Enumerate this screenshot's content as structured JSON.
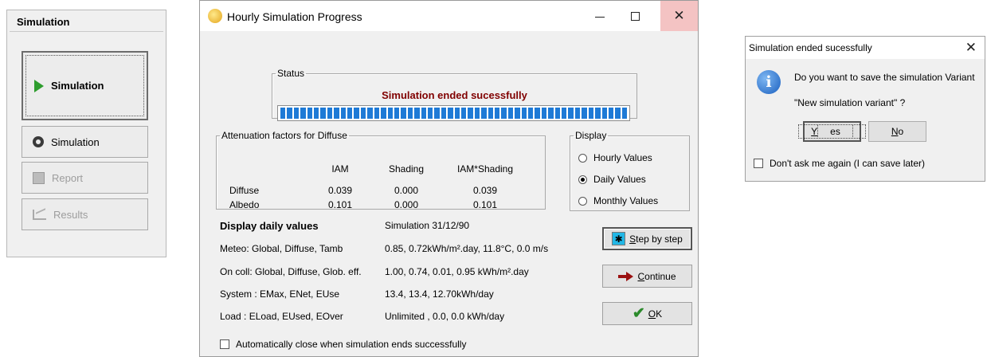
{
  "side_panel": {
    "title": "Simulation",
    "main_button": "Simulation",
    "buttons": [
      {
        "label": "Simulation",
        "icon": "gear-icon",
        "enabled": true
      },
      {
        "label": "Report",
        "icon": "report-icon",
        "enabled": false
      },
      {
        "label": "Results",
        "icon": "chart-icon",
        "enabled": false
      }
    ]
  },
  "progress_window": {
    "title": "Hourly Simulation Progress",
    "controls": {
      "minimize": "—",
      "close": "✕"
    },
    "status": {
      "legend": "Status",
      "message": "Simulation ended sucessfully",
      "progress": 100
    },
    "attenuation": {
      "legend": "Attenuation factors for Diffuse",
      "columns": [
        "IAM",
        "Shading",
        "IAM*Shading"
      ],
      "rows": [
        {
          "label": "Diffuse",
          "values": [
            "0.039",
            "0.000",
            "0.039"
          ]
        },
        {
          "label": "Albedo",
          "values": [
            "0.101",
            "0.000",
            "0.101"
          ]
        }
      ]
    },
    "display": {
      "legend": "Display",
      "options": [
        "Hourly Values",
        "Daily Values",
        "Monthly Values"
      ],
      "selected": "Daily Values"
    },
    "daily": {
      "title": "Display daily values",
      "title_value": "Simulation 31/12/90",
      "rows": [
        {
          "label": "Meteo:  Global,  Diffuse, Tamb",
          "value": "0.85,  0.72kWh/m².day,  11.8°C,  0.0 m/s"
        },
        {
          "label": "On coll: Global,  Diffuse, Glob. eff.",
          "value": "1.00,  0.74,  0.01,  0.95 kWh/m².day"
        },
        {
          "label": "System : EMax, ENet, EUse",
          "value": "13.4,  13.4,  12.70kWh/day"
        },
        {
          "label": "Load :  ELoad, EUsed, EOver",
          "value": "Unlimited , 0.0,  0.0 kWh/day"
        }
      ]
    },
    "buttons": {
      "step_prefix": "",
      "step_u": "S",
      "step_rest": "tep by step",
      "continue_u": "C",
      "continue_rest": "ontinue",
      "ok_u": "O",
      "ok_rest": "K"
    },
    "auto_close": {
      "label": "Automatically close when simulation ends successfully",
      "checked": false
    }
  },
  "dialog": {
    "title": "Simulation ended sucessfully",
    "close": "✕",
    "message_line1": "Do you want to save the simulation Variant",
    "message_line2": "\"New simulation variant\"  ?",
    "yes_u": "Y",
    "yes_rest": "es",
    "no_u": "N",
    "no_rest": "o",
    "dont_ask": {
      "label": "Don't ask me again (I can save later)",
      "checked": false
    }
  }
}
